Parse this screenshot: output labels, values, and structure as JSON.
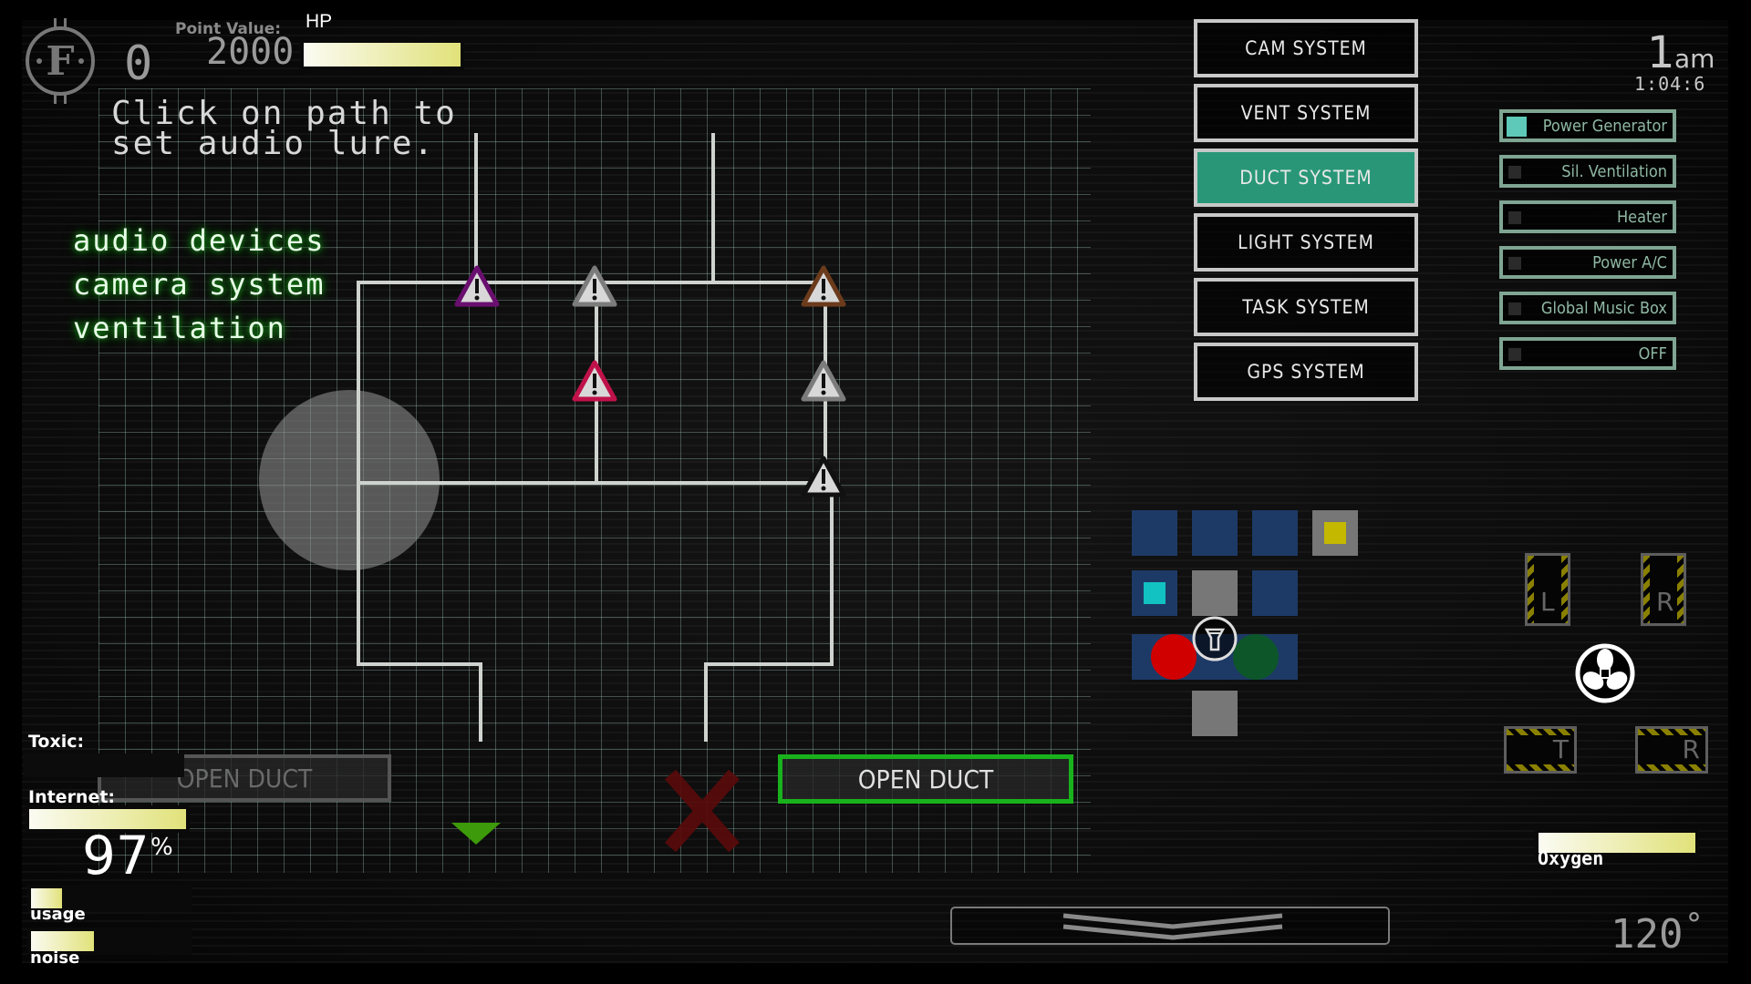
{
  "header": {
    "logo_letter": "F",
    "score": "0",
    "point_value_label": "Point Value:",
    "point_value": "2000",
    "hp_label": "HP",
    "hp_fraction": 1.0
  },
  "instructions": "Click on path to\nset audio lure.",
  "mode_list": [
    "audio devices",
    "camera system",
    "ventilation"
  ],
  "duct_map": {
    "lure_active": true,
    "hazards": [
      {
        "name": "hazard-purple",
        "color": "#6a0f6f"
      },
      {
        "name": "hazard-grey-1",
        "color": "#7c7c7c"
      },
      {
        "name": "hazard-brown",
        "color": "#6b3b1c"
      },
      {
        "name": "hazard-red",
        "color": "#c0124a"
      },
      {
        "name": "hazard-grey-2",
        "color": "#7c7c7c"
      },
      {
        "name": "hazard-black",
        "color": "#111111"
      }
    ],
    "open_duct_left_label": "OPEN DUCT",
    "open_duct_right_label": "OPEN DUCT",
    "open_duct_right_active": true,
    "open_duct_left_active": false
  },
  "status": {
    "toxic_label": "Toxic:",
    "toxic_fraction": 0,
    "internet_label": "Internet:",
    "internet_fraction": 1.0,
    "internet_percent": "97",
    "percent_sign": "%",
    "usage_label": "usage",
    "usage_fraction": 0.2,
    "noise_label": "noise",
    "noise_fraction": 0.4
  },
  "systems": [
    {
      "label": "CAM SYSTEM",
      "active": false
    },
    {
      "label": "VENT SYSTEM",
      "active": false
    },
    {
      "label": "DUCT SYSTEM",
      "active": true
    },
    {
      "label": "LIGHT SYSTEM",
      "active": false
    },
    {
      "label": "TASK SYSTEM",
      "active": false
    },
    {
      "label": "GPS SYSTEM",
      "active": false
    }
  ],
  "clock": {
    "hour": "1",
    "ampm": "am",
    "elapsed": "1:04:6"
  },
  "toggles": [
    {
      "label": "Power Generator",
      "on": true
    },
    {
      "label": "Sil. Ventilation",
      "on": false
    },
    {
      "label": "Heater",
      "on": false
    },
    {
      "label": "Power A/C",
      "on": false
    },
    {
      "label": "Global Music Box",
      "on": false
    },
    {
      "label": "OFF",
      "on": false
    }
  ],
  "office_map": {
    "colors": {
      "room": "#1d3a66",
      "grey": "#777777",
      "yellow": "#c4b800",
      "cyan": "#12c1c1",
      "red": "#d00000",
      "green": "#0b5a24"
    }
  },
  "doors": {
    "left": "L",
    "right": "R",
    "top": "T",
    "right_vent": "R"
  },
  "oxygen": {
    "label": "Oxygen",
    "fraction": 1.0
  },
  "temperature": {
    "value": "120",
    "unit": "°"
  }
}
